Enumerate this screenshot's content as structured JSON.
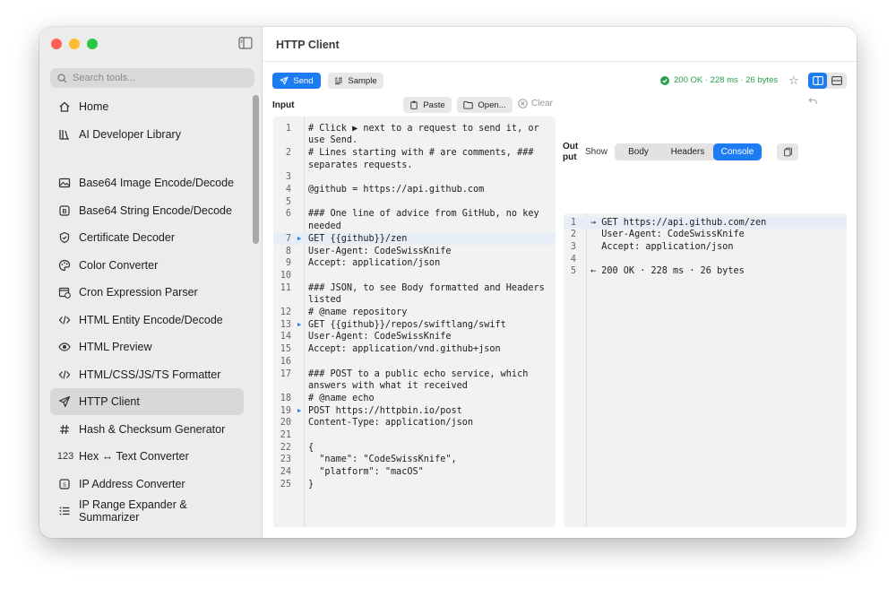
{
  "window": {
    "title": "HTTP Client"
  },
  "sidebar": {
    "search_placeholder": "Search tools...",
    "items": [
      {
        "label": "Home",
        "icon": "house-icon"
      },
      {
        "label": "AI Developer Library",
        "icon": "library-icon"
      },
      {
        "label": "Base64 Image Encode/Decode",
        "icon": "photo-icon"
      },
      {
        "label": "Base64 String Encode/Decode",
        "icon": "b-square-icon"
      },
      {
        "label": "Certificate Decoder",
        "icon": "shield-check-icon"
      },
      {
        "label": "Color Converter",
        "icon": "palette-icon"
      },
      {
        "label": "Cron Expression Parser",
        "icon": "calendar-clock-icon"
      },
      {
        "label": "HTML Entity Encode/Decode",
        "icon": "code-brackets-icon"
      },
      {
        "label": "HTML Preview",
        "icon": "eye-icon"
      },
      {
        "label": "HTML/CSS/JS/TS Formatter",
        "icon": "code-brackets-icon"
      },
      {
        "label": "HTTP Client",
        "icon": "paper-plane-icon"
      },
      {
        "label": "Hash & Checksum Generator",
        "icon": "hash-icon"
      },
      {
        "label": "Hex ↔ Text Converter",
        "icon": "123-icon"
      },
      {
        "label": "IP Address Converter",
        "icon": "number-square-icon"
      },
      {
        "label": "IP Range Expander & Summarizer",
        "icon": "list-icon"
      }
    ]
  },
  "toolbar": {
    "send_label": "Send",
    "sample_label": "Sample",
    "status_text": "200 OK · 228 ms · 26 bytes"
  },
  "input": {
    "label": "Input",
    "paste_label": "Paste",
    "open_label": "Open...",
    "clear_label": "Clear",
    "lines": [
      {
        "n": "1",
        "text": "# Click ▶ next to a request to send it, or"
      },
      {
        "n": "",
        "text": "use Send."
      },
      {
        "n": "2",
        "text": "# Lines starting with # are comments, ###"
      },
      {
        "n": "",
        "text": "separates requests."
      },
      {
        "n": "3",
        "text": ""
      },
      {
        "n": "4",
        "text": "@github = https://api.github.com"
      },
      {
        "n": "5",
        "text": ""
      },
      {
        "n": "6",
        "text": "### One line of advice from GitHub, no key"
      },
      {
        "n": "",
        "text": "needed"
      },
      {
        "n": "7",
        "text": "GET {{github}}/zen",
        "arrow": true,
        "highlight": true
      },
      {
        "n": "8",
        "text": "User-Agent: CodeSwissKnife"
      },
      {
        "n": "9",
        "text": "Accept: application/json"
      },
      {
        "n": "10",
        "text": ""
      },
      {
        "n": "11",
        "text": "### JSON, to see Body formatted and Headers"
      },
      {
        "n": "",
        "text": "listed"
      },
      {
        "n": "12",
        "text": "# @name repository"
      },
      {
        "n": "13",
        "text": "GET {{github}}/repos/swiftlang/swift",
        "arrow": true
      },
      {
        "n": "14",
        "text": "User-Agent: CodeSwissKnife"
      },
      {
        "n": "15",
        "text": "Accept: application/vnd.github+json"
      },
      {
        "n": "16",
        "text": ""
      },
      {
        "n": "17",
        "text": "### POST to a public echo service, which"
      },
      {
        "n": "",
        "text": "answers with what it received"
      },
      {
        "n": "18",
        "text": "# @name echo"
      },
      {
        "n": "19",
        "text": "POST https://httpbin.io/post",
        "arrow": true
      },
      {
        "n": "20",
        "text": "Content-Type: application/json"
      },
      {
        "n": "21",
        "text": ""
      },
      {
        "n": "22",
        "text": "{"
      },
      {
        "n": "23",
        "text": "  \"name\": \"CodeSwissKnife\","
      },
      {
        "n": "24",
        "text": "  \"platform\": \"macOS\""
      },
      {
        "n": "25",
        "text": "}"
      }
    ]
  },
  "output": {
    "label": "Out put",
    "show_label": "Show",
    "tabs": [
      "Body",
      "Headers",
      "Console"
    ],
    "active_tab": "Console",
    "lines": [
      {
        "n": "1",
        "text": "→ GET https://api.github.com/zen",
        "highlight": true
      },
      {
        "n": "2",
        "text": "  User-Agent: CodeSwissKnife"
      },
      {
        "n": "3",
        "text": "  Accept: application/json"
      },
      {
        "n": "4",
        "text": ""
      },
      {
        "n": "5",
        "text": "← 200 OK · 228 ms · 26 bytes"
      }
    ]
  },
  "colors": {
    "accent": "#1e7cf2",
    "success": "#2aa04a"
  }
}
